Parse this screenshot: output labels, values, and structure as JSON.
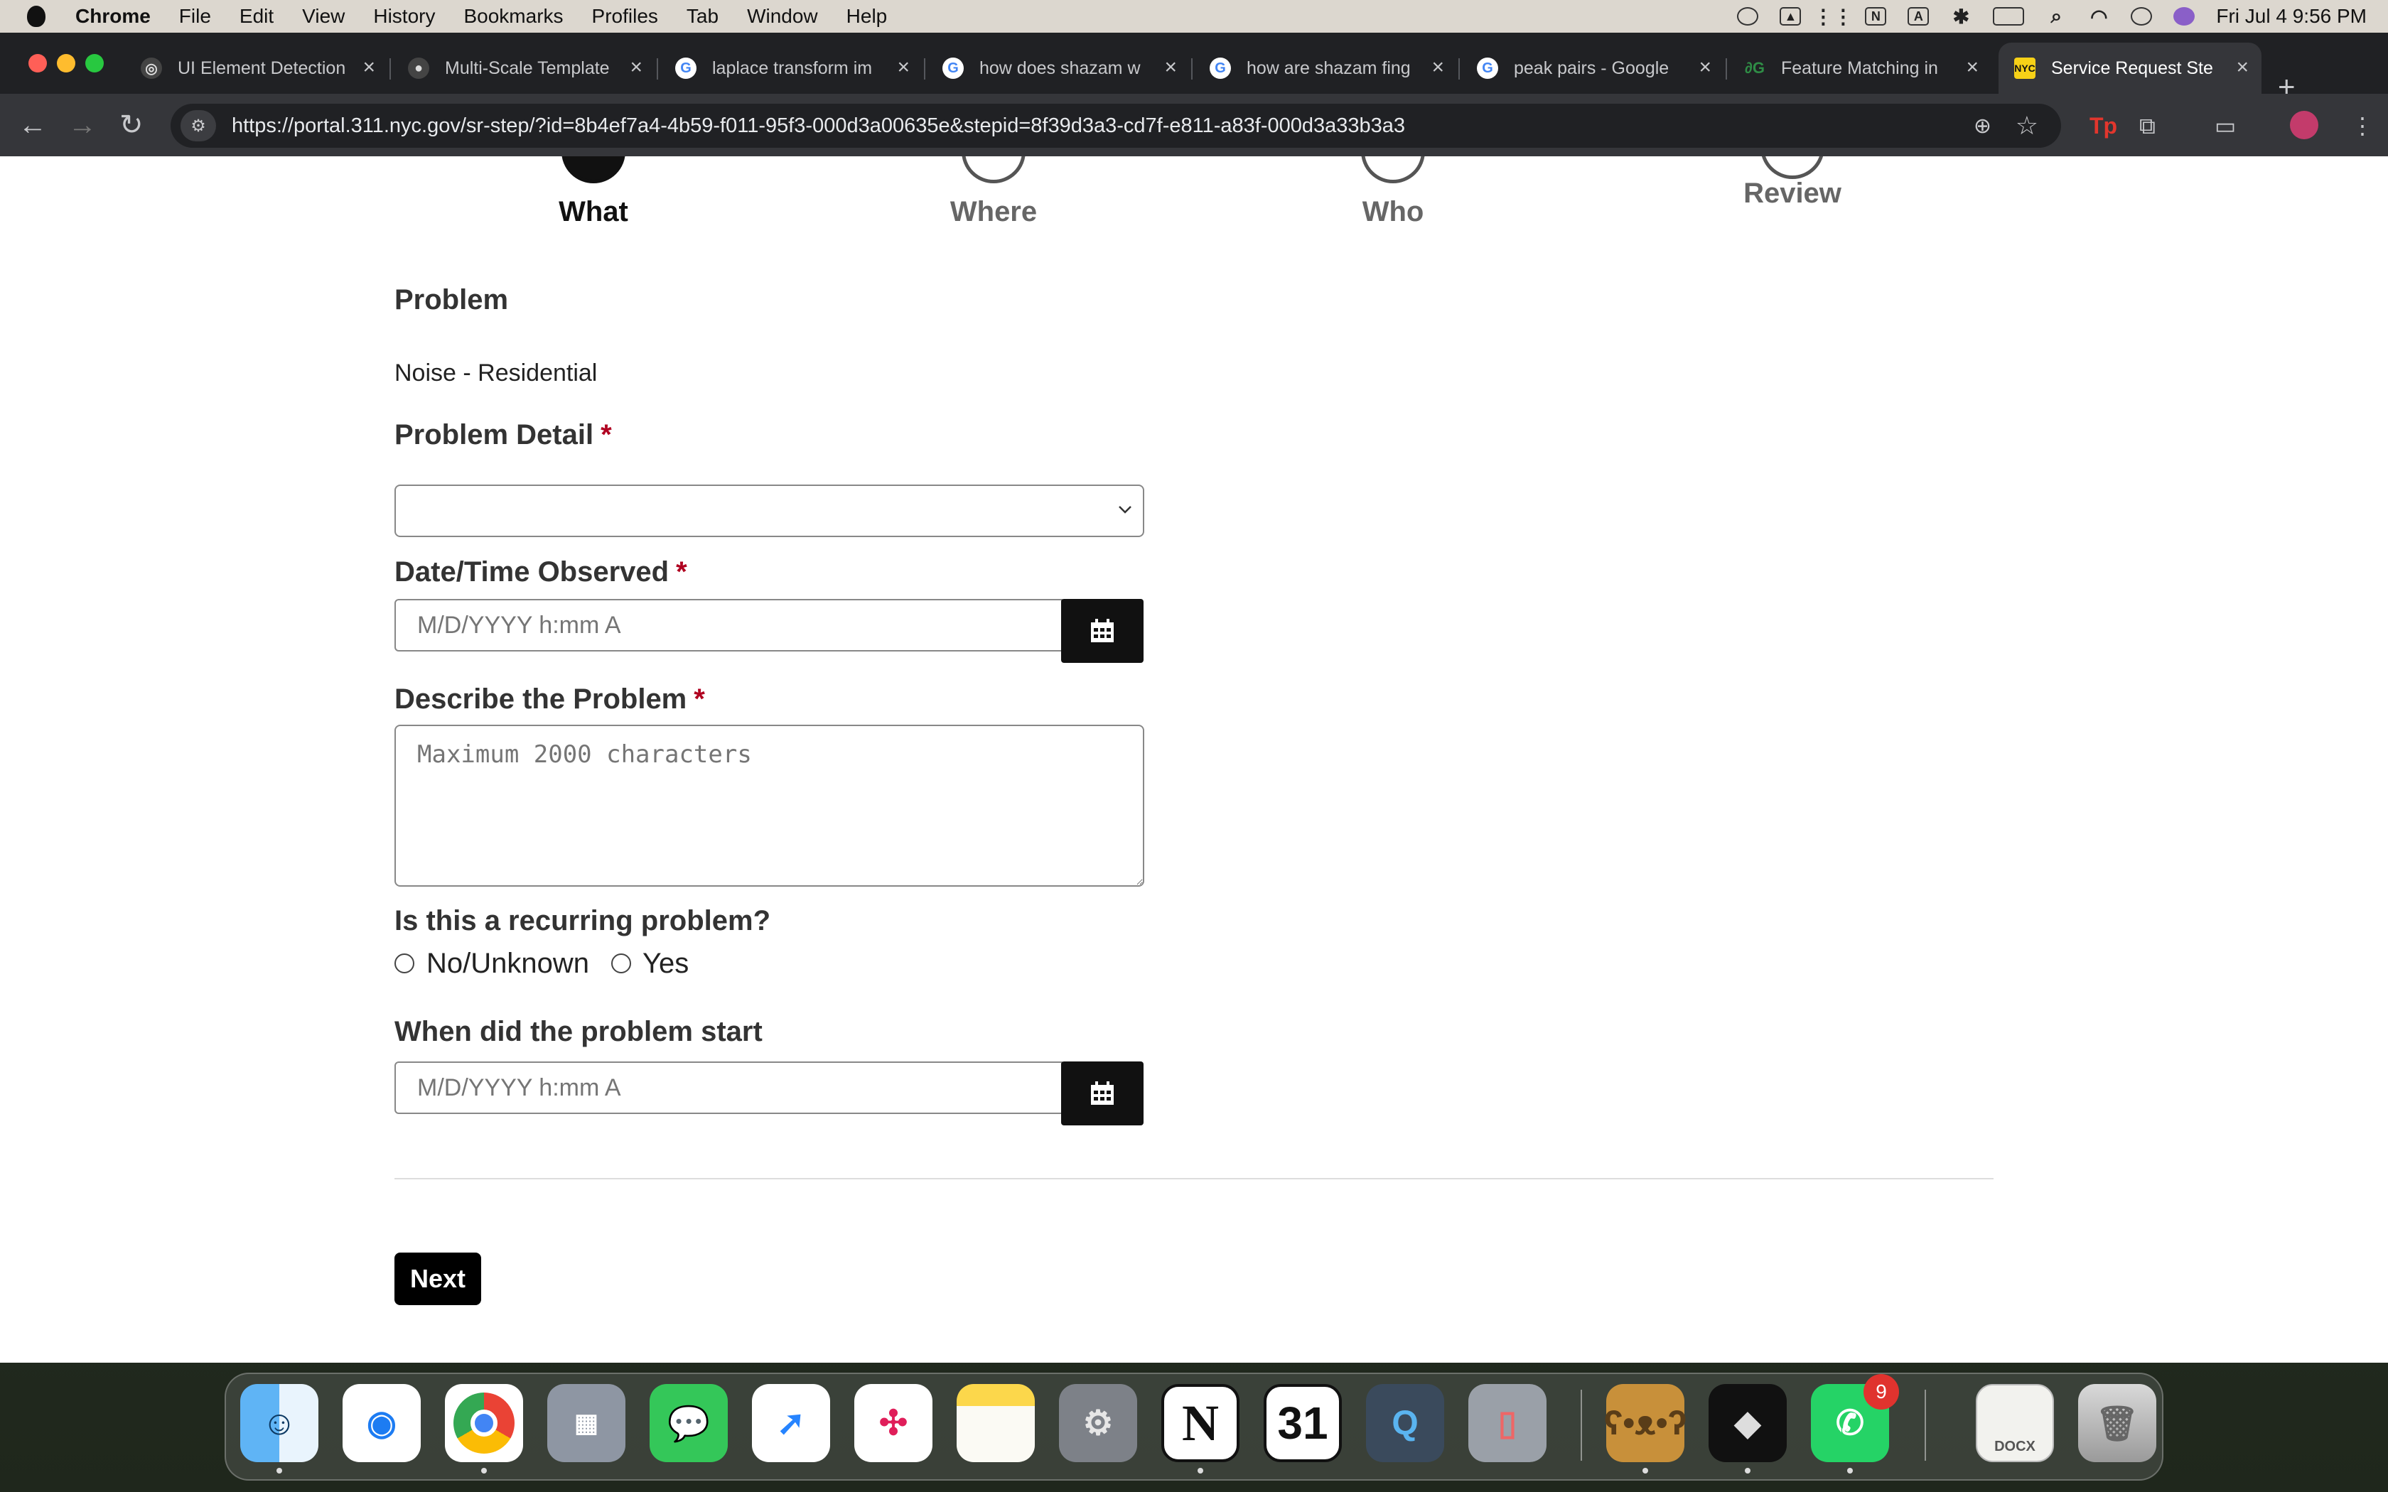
{
  "menubar": {
    "app_name": "Chrome",
    "items": [
      "File",
      "Edit",
      "View",
      "History",
      "Bookmarks",
      "Profiles",
      "Tab",
      "Window",
      "Help"
    ],
    "datetime": "Fri Jul 4  9:56 PM"
  },
  "browser": {
    "tabs": [
      {
        "title": "UI Element Detection"
      },
      {
        "title": "Multi-Scale Template"
      },
      {
        "title": "laplace transform im"
      },
      {
        "title": "how does shazam w"
      },
      {
        "title": "how are shazam fing"
      },
      {
        "title": "peak pairs - Google"
      },
      {
        "title": "Feature Matching in"
      },
      {
        "title": "Service Request Ste"
      }
    ],
    "active_tab_index": 7,
    "url": "https://portal.311.nyc.gov/sr-step/?id=8b4ef7a4-4b59-f011-95f3-000d3a00635e&stepid=8f39d3a3-cd7f-e811-a83f-000d3a33b3a3"
  },
  "steps": [
    {
      "label": "What",
      "active": true
    },
    {
      "label": "Where",
      "active": false
    },
    {
      "label": "Who",
      "active": false
    },
    {
      "label": "Review",
      "active": false
    }
  ],
  "form": {
    "problem_label": "Problem",
    "problem_value": "Noise - Residential",
    "problem_detail_label": "Problem Detail",
    "required_mark": "*",
    "problem_detail_value": "",
    "datetime_label": "Date/Time Observed",
    "datetime_placeholder": "M/D/YYYY h:mm A",
    "describe_label": "Describe the Problem",
    "describe_placeholder": "Maximum 2000 characters",
    "recurring_label": "Is this a recurring problem?",
    "recurring_options": [
      "No/Unknown",
      "Yes"
    ],
    "start_label": "When did the problem start",
    "start_placeholder": "M/D/YYYY h:mm A",
    "next_label": "Next"
  },
  "dock": {
    "apps": [
      "Finder",
      "Safari",
      "Chrome",
      "Launchpad",
      "Messages",
      "Jira",
      "Slack",
      "Notes",
      "System Settings",
      "Notion",
      "Calendar",
      "QuickTime",
      "iPhone Mirroring",
      "Bear",
      "Cursor",
      "WhatsApp",
      "Document",
      "Trash"
    ],
    "calendar_day": "31",
    "notion_letter": "N",
    "whatsapp_badge": "9",
    "docx_label": "DOCX"
  }
}
